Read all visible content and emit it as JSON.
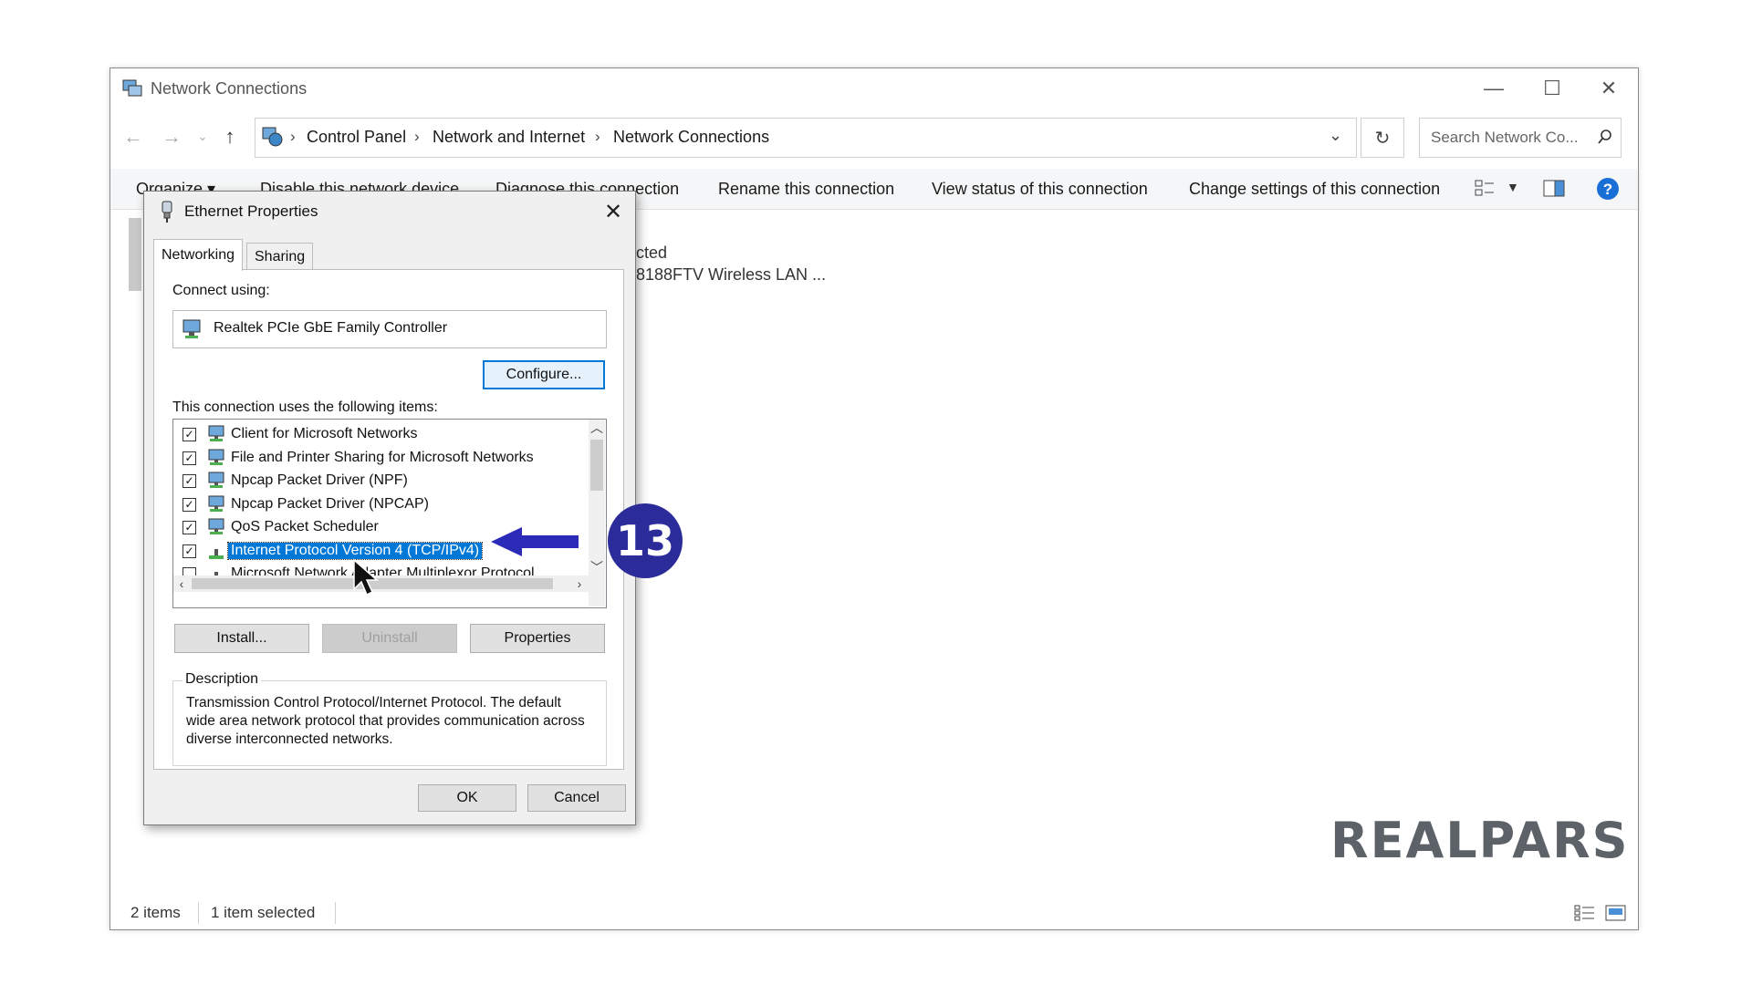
{
  "window": {
    "title": "Network Connections",
    "minimize_label": "—",
    "maximize_label": "☐",
    "close_label": "✕"
  },
  "address": {
    "breadcrumb": [
      "Control Panel",
      "Network and Internet",
      "Network Connections"
    ],
    "search_placeholder": "Search Network Co..."
  },
  "toolbar": {
    "organize": "Organize ▾",
    "disable": "Disable this network device",
    "diagnose": "Diagnose this connection",
    "rename": "Rename this connection",
    "view_status": "View status of this connection",
    "change_settings": "Change settings of this connection"
  },
  "files": {
    "status_fragment": "cted",
    "device_fragment": "8188FTV Wireless LAN ..."
  },
  "statusbar": {
    "item_count": "2 items",
    "selected_count": "1 item selected"
  },
  "dialog": {
    "title": "Ethernet Properties",
    "tabs": [
      "Networking",
      "Sharing"
    ],
    "connect_using_label": "Connect using:",
    "adapter_name": "Realtek PCIe GbE Family Controller",
    "configure_label": "Configure...",
    "items_label": "This connection uses the following items:",
    "items": [
      {
        "label": "Client for Microsoft Networks",
        "checked": true,
        "icon": "network-client-icon"
      },
      {
        "label": "File and Printer Sharing for Microsoft Networks",
        "checked": true,
        "icon": "network-service-icon"
      },
      {
        "label": "Npcap Packet Driver (NPF)",
        "checked": true,
        "icon": "network-service-icon"
      },
      {
        "label": "Npcap Packet Driver (NPCAP)",
        "checked": true,
        "icon": "network-service-icon"
      },
      {
        "label": "QoS Packet Scheduler",
        "checked": true,
        "icon": "network-service-icon"
      },
      {
        "label": "Internet Protocol Version 4 (TCP/IPv4)",
        "checked": true,
        "selected": true,
        "icon": "protocol-icon"
      },
      {
        "label": "Microsoft Network Adapter Multiplexor Protocol",
        "checked": false,
        "icon": "protocol-icon"
      }
    ],
    "install_label": "Install...",
    "uninstall_label": "Uninstall",
    "properties_label": "Properties",
    "description_legend": "Description",
    "description_text": "Transmission Control Protocol/Internet Protocol. The default wide area network protocol that provides communication across diverse interconnected networks.",
    "ok_label": "OK",
    "cancel_label": "Cancel"
  },
  "annotation": {
    "step_number": "13",
    "arrow_color": "#2b2bb8"
  },
  "brand": {
    "logo_text": "REALPARS"
  },
  "colors": {
    "selection": "#0078d7",
    "help_icon": "#1a6fd6",
    "callout": "#2b2b9a"
  }
}
